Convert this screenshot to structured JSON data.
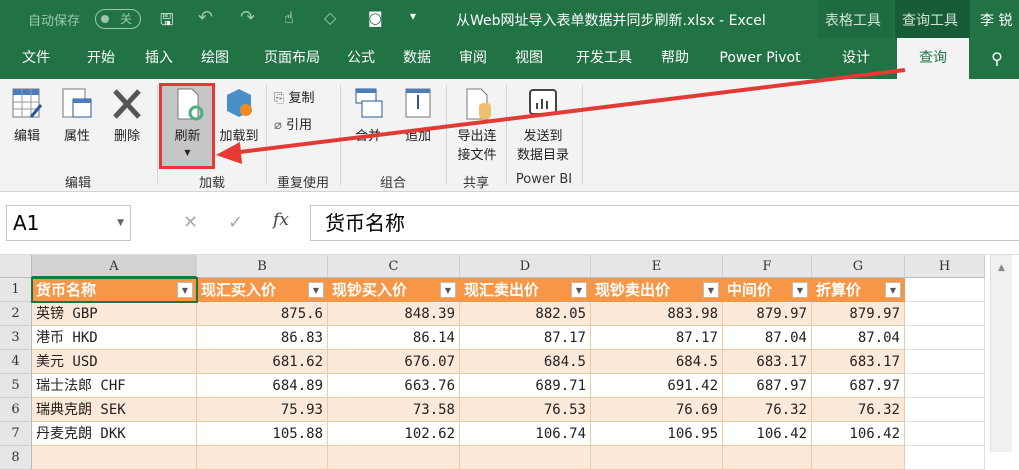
{
  "titlebar": {
    "autosave_label": "自动保存",
    "autosave_state": "关",
    "title": "从Web网址导入表单数据并同步刷新.xlsx  -  Excel",
    "context_tab_1": "表格工具",
    "context_tab_2": "查询工具",
    "user": "李 锐"
  },
  "tabs": [
    "文件",
    "开始",
    "插入",
    "绘图",
    "页面布局",
    "公式",
    "数据",
    "审阅",
    "视图",
    "开发工具",
    "帮助",
    "Power Pivot",
    "设计",
    "查询"
  ],
  "active_tab": "查询",
  "tell_me_icon": "search-icon",
  "ribbon": {
    "edit": {
      "buttons": [
        "编辑",
        "属性",
        "删除"
      ],
      "label": "编辑"
    },
    "load": {
      "refresh": "刷新",
      "load_to": "加载到",
      "label": "加载"
    },
    "reuse": {
      "copy": "复制",
      "reference": "引用",
      "label": "重复使用"
    },
    "combine": {
      "merge": "合并",
      "append": "追加",
      "label": "组合"
    },
    "share": {
      "export_line1": "导出连",
      "export_line2": "接文件",
      "label": "共享"
    },
    "powerbi": {
      "send_line1": "发送到",
      "send_line2": "数据目录",
      "label": "Power BI"
    }
  },
  "formula_bar": {
    "name_box": "A1",
    "fx": "fx",
    "content": "货币名称"
  },
  "sheet": {
    "columns": [
      "A",
      "B",
      "C",
      "D",
      "E",
      "F",
      "G",
      "H"
    ],
    "row_numbers": [
      "1",
      "2",
      "3",
      "4",
      "5",
      "6",
      "7",
      "8"
    ],
    "headers": [
      "货币名称",
      "现汇买入价",
      "现钞买入价",
      "现汇卖出价",
      "现钞卖出价",
      "中间价",
      "折算价"
    ],
    "rows": [
      [
        "英镑 GBP",
        "875.6",
        "848.39",
        "882.05",
        "883.98",
        "879.97",
        "879.97"
      ],
      [
        "港币 HKD",
        "86.83",
        "86.14",
        "87.17",
        "87.17",
        "87.04",
        "87.04"
      ],
      [
        "美元 USD",
        "681.62",
        "676.07",
        "684.5",
        "684.5",
        "683.17",
        "683.17"
      ],
      [
        "瑞士法郎 CHF",
        "684.89",
        "663.76",
        "689.71",
        "691.42",
        "687.97",
        "687.97"
      ],
      [
        "瑞典克朗 SEK",
        "75.93",
        "73.58",
        "76.53",
        "76.69",
        "76.32",
        "76.32"
      ],
      [
        "丹麦克朗 DKK",
        "105.88",
        "102.62",
        "106.74",
        "106.95",
        "106.42",
        "106.42"
      ]
    ]
  },
  "colors": {
    "excel_green": "#217346",
    "table_header": "#f79646",
    "band": "#fde9d9",
    "annotation": "#e53935"
  }
}
